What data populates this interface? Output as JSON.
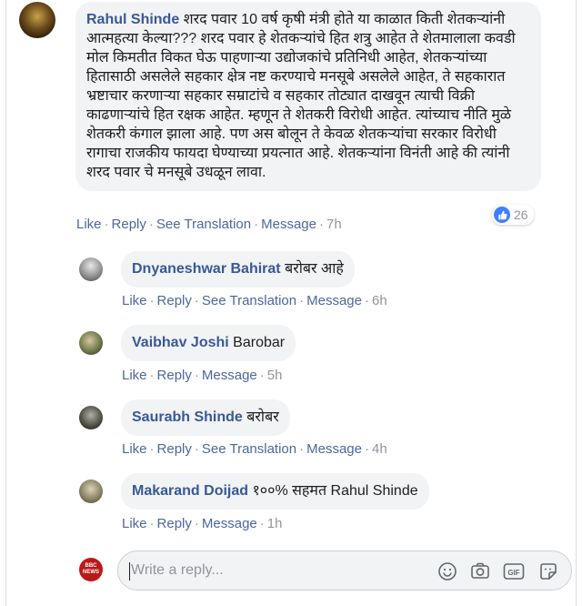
{
  "comments": [
    {
      "author": "Rahul Shinde",
      "text": "शरद पवार 10 वर्ष कृषी मंत्री होते या काळात किती शेतकऱ्यांनी आत्महत्या केल्या??? शरद पवार हे शेतकऱ्यांचे हित शत्रु आहेत ते शेतमालाला कवडी मोल किमतीत विकत घेऊ पाहणाऱ्या उद्योजकांचे प्रतिनिधी आहेत, शेतकऱ्यांच्या हितासाठी असलेले सहकार क्षेत्र नष्ट करण्याचे मनसूबे असलेले आहेत, ते सहकारात भ्रष्टाचार करणाऱ्या सहकार सम्राटांचे व सहकार तोट्यात दाखवून त्याची विक्री काढणाऱ्यांचे हित रक्षक आहेत. म्हणून ते शेतकरी विरोधी आहेत. त्यांच्याच नीति मुळे शेतकरी कंगाल झाला आहे. पण अस बोलून ते केवळ शेतकऱ्यांचा सरकार विरोधी रागाचा राजकीय फायदा घेण्याच्या प्रयत्नात आहे. शेतकऱ्यांना विनंती आहे की त्यांनी शरद पवार चे मनसूबे उधळून लावा.",
      "actions": [
        "Like",
        "Reply",
        "See Translation",
        "Message"
      ],
      "time": "7h",
      "like_count": "26"
    }
  ],
  "replies": [
    {
      "author": "Dnyaneshwar Bahirat",
      "text": "बरोबर आहे",
      "actions": [
        "Like",
        "Reply",
        "See Translation",
        "Message"
      ],
      "time": "6h"
    },
    {
      "author": "Vaibhav Joshi",
      "text": "Barobar",
      "actions": [
        "Like",
        "Reply",
        "Message"
      ],
      "time": "5h"
    },
    {
      "author": "Saurabh Shinde",
      "text": "बरोबर",
      "actions": [
        "Like",
        "Reply",
        "See Translation",
        "Message"
      ],
      "time": "4h"
    },
    {
      "author": "Makarand Doijad",
      "text": "१००% सहमत Rahul Shinde",
      "actions": [
        "Like",
        "Reply",
        "Message"
      ],
      "time": "1h"
    }
  ],
  "reply_box": {
    "placeholder": "Write a reply...",
    "avatar_label": "BBC NEWS",
    "icons": [
      "emoji-icon",
      "camera-icon",
      "gif-icon",
      "sticker-icon"
    ]
  },
  "colors": {
    "author": "#385898",
    "link": "#4b67a1",
    "meta": "#90949c",
    "bubble": "#f2f3f5",
    "like_badge": "#4080ff",
    "bbc_red": "#bb1919"
  }
}
